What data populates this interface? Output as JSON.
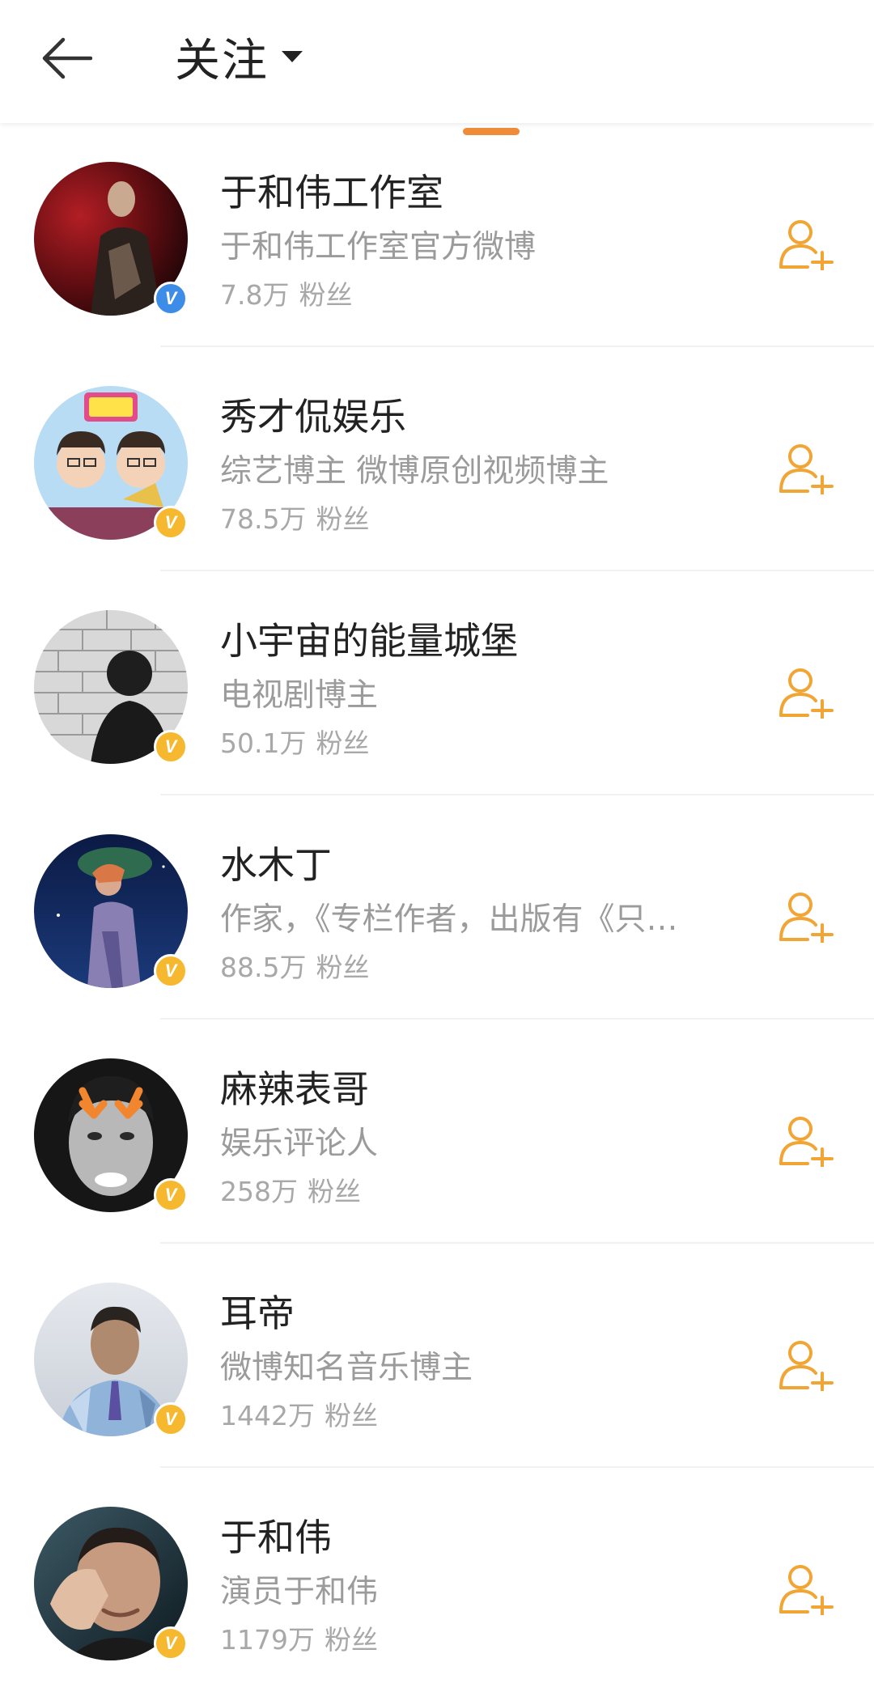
{
  "header": {
    "back_icon": "arrow-left-icon",
    "title": "关注",
    "dropdown_icon": "caret-down-icon"
  },
  "colors": {
    "accent": "#F08B39",
    "follow_icon": "#F0A534",
    "badge_blue": "#3D8DE8",
    "badge_gold": "#F5B82E"
  },
  "users": [
    {
      "name": "于和伟工作室",
      "desc": "于和伟工作室官方微博",
      "fans_count": "7.8万",
      "fans_label": "粉丝",
      "badge": "V",
      "badge_color": "blue"
    },
    {
      "name": "秀才侃娱乐",
      "desc": "综艺博主 微博原创视频博主",
      "fans_count": "78.5万",
      "fans_label": "粉丝",
      "badge": "V",
      "badge_color": "gold"
    },
    {
      "name": "小宇宙的能量城堡",
      "desc": "电视剧博主",
      "fans_count": "50.1万",
      "fans_label": "粉丝",
      "badge": "V",
      "badge_color": "gold"
    },
    {
      "name": "水木丁",
      "desc": "作家，《专栏作者，出版有《只…",
      "fans_count": "88.5万",
      "fans_label": "粉丝",
      "badge": "V",
      "badge_color": "gold"
    },
    {
      "name": "麻辣表哥",
      "desc": "娱乐评论人",
      "fans_count": "258万",
      "fans_label": "粉丝",
      "badge": "V",
      "badge_color": "gold"
    },
    {
      "name": "耳帝",
      "desc": "微博知名音乐博主",
      "fans_count": "1442万",
      "fans_label": "粉丝",
      "badge": "V",
      "badge_color": "gold"
    },
    {
      "name": "于和伟",
      "desc": "演员于和伟",
      "fans_count": "1179万",
      "fans_label": "粉丝",
      "badge": "V",
      "badge_color": "gold"
    }
  ],
  "follow_icon": "add-user-icon"
}
